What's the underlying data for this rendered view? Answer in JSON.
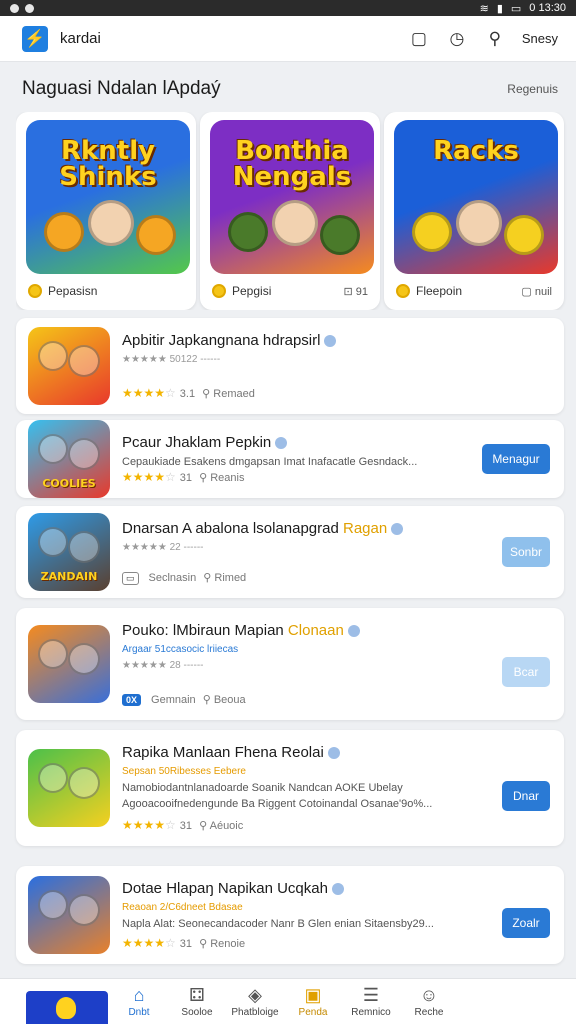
{
  "status": {
    "time": "0 13:30"
  },
  "appbar": {
    "name": "kardai",
    "search_label": "Snesy"
  },
  "section": {
    "title": "Naguasi Ndalan lApdaý",
    "link": "Regenuis"
  },
  "featured": [
    {
      "title": "Rkntly Shinks",
      "meta": "Pepasisn",
      "extra": "",
      "colors": [
        "#2a6fe0",
        "#54c84a",
        "#f5a623"
      ]
    },
    {
      "title": "Bonthia Nengals",
      "meta": "Pepgisi",
      "extra": "⊡ 91",
      "colors": [
        "#7d2ec4",
        "#f58b1f",
        "#4a7a2a"
      ]
    },
    {
      "title": "Racks",
      "meta": "Fleepoin",
      "extra": "▢ nuil",
      "colors": [
        "#1b5fd8",
        "#e8392b",
        "#f5d020"
      ]
    }
  ],
  "apps": [
    {
      "title": "Apbitir Japkangnana hdrapsirl",
      "title_accent": "",
      "sub": "★★★★★ 50122 ------",
      "sub_style": "grey",
      "desc": [],
      "stars_full": 4,
      "stars_half": 1,
      "stars_empty": 0,
      "rating": "3.1",
      "meta_label": "Remaed",
      "tag": "",
      "button": "",
      "thumb_label": "",
      "thumb_colors": [
        "#f5c518",
        "#e8392b"
      ]
    },
    {
      "title": "Pcaur Jhaklam Pepkin",
      "title_accent": "",
      "sub": "",
      "sub_style": "grey",
      "desc": [
        "Cepaukiade Esakens dmgapsan Imat Inafacatle Gesndack..."
      ],
      "stars_full": 4,
      "stars_half": 1,
      "stars_empty": 0,
      "rating": "31",
      "meta_label": "Reanis",
      "tag": "",
      "button": "Menagur",
      "button_style": "solid",
      "thumb_label": "COOLIES",
      "thumb_colors": [
        "#36c0f0",
        "#e8392b"
      ]
    },
    {
      "title": "Dnarsan A abalona lsolanapgrad",
      "title_accent": "Ragan",
      "sub": "★★★★★ 22 ------",
      "sub_style": "grey",
      "desc": [],
      "stars_full": 0,
      "stars_half": 0,
      "stars_empty": 0,
      "rating": "",
      "meta_label": "Rimed",
      "tag": "▭",
      "tag_label": "Seclnasin",
      "button": "Sonbr",
      "button_style": "light",
      "thumb_label": "ZANDAIN",
      "thumb_colors": [
        "#2e9be8",
        "#5a4030"
      ]
    },
    {
      "title": "Pouko: lMbiraun Mapian",
      "title_accent": "Clonaan",
      "sub": "Argaar 51ccasocic lriiecas",
      "sub_style": "blue",
      "sub2": "★★★★★ 28 ------",
      "desc": [],
      "stars_full": 0,
      "stars_half": 0,
      "stars_empty": 0,
      "rating": "",
      "meta_label": "Beoua",
      "tag": "0X",
      "tag_label": "Gemnain",
      "button": "Bcar",
      "button_style": "lighter",
      "thumb_label": "",
      "thumb_colors": [
        "#f58b1f",
        "#3a6fd8"
      ]
    },
    {
      "title": "Rapika Manlaan Fhena Reolai",
      "title_accent": "",
      "sub": "Sepsan 50Ribesses Eebere",
      "sub_style": "orange",
      "desc": [
        "Namobiodantnlanadoarde Soanik Nandcan AOKE Ubelay",
        "Agooacooifnedengunde Ba Riggent Cotoinandal Osanae'9o%..."
      ],
      "stars_full": 4,
      "stars_half": 1,
      "stars_empty": 0,
      "rating": "31",
      "meta_label": "Aéuoic",
      "tag": "",
      "button": "Dnar",
      "button_style": "solid",
      "thumb_label": "",
      "thumb_colors": [
        "#4cc04a",
        "#f5d020"
      ]
    },
    {
      "title": "Dotae Hlapaŋ Napikan Ucqkah",
      "title_accent": "",
      "sub": "Reaoan 2/C6dneet Bdasae",
      "sub_style": "orange",
      "desc": [
        "Napla Alat: Seonecandacoder Nanr B Glen enian Sitaensby29..."
      ],
      "stars_full": 4,
      "stars_half": 1,
      "stars_empty": 0,
      "rating": "31",
      "meta_label": "Renoie",
      "tag": "",
      "button": "Zoalr",
      "button_style": "solid",
      "thumb_label": "",
      "thumb_colors": [
        "#2a6fe0",
        "#e8812b"
      ]
    }
  ],
  "nav": [
    {
      "label": "Dnbt",
      "icon": "⌂",
      "name": "home"
    },
    {
      "label": "Sooloe",
      "icon": "⚃",
      "name": "games"
    },
    {
      "label": "Phatbloige",
      "icon": "◈",
      "name": "apps"
    },
    {
      "label": "Penda",
      "icon": "▣",
      "name": "books"
    },
    {
      "label": "Remnico",
      "icon": "☰",
      "name": "notifications"
    },
    {
      "label": "Reche",
      "icon": "☺",
      "name": "profile"
    }
  ]
}
